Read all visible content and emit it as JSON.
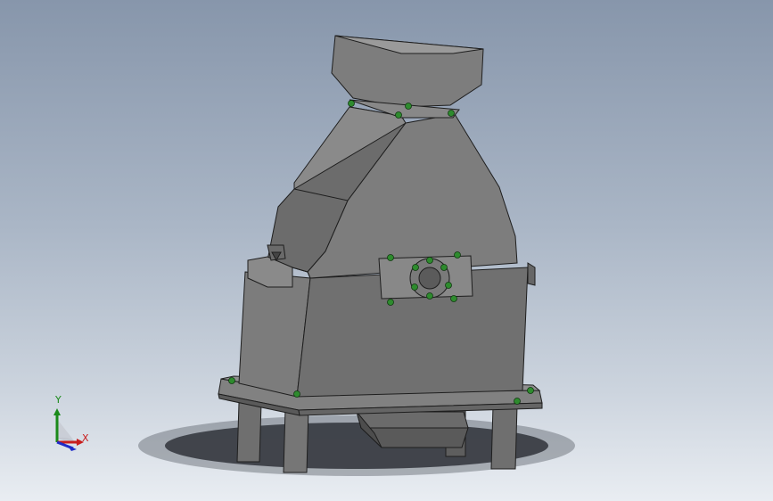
{
  "triad": {
    "y_label": "Y",
    "x_label": "X",
    "colors": {
      "x": "#c81e1e",
      "y": "#1a8a1a",
      "z": "#1e2ac8"
    }
  },
  "model": {
    "colors": {
      "body": "#7a7a7a",
      "body_dark": "#5d5d5d",
      "body_light": "#909090",
      "edge": "#222222",
      "bolt": "#2e8b2e"
    }
  }
}
